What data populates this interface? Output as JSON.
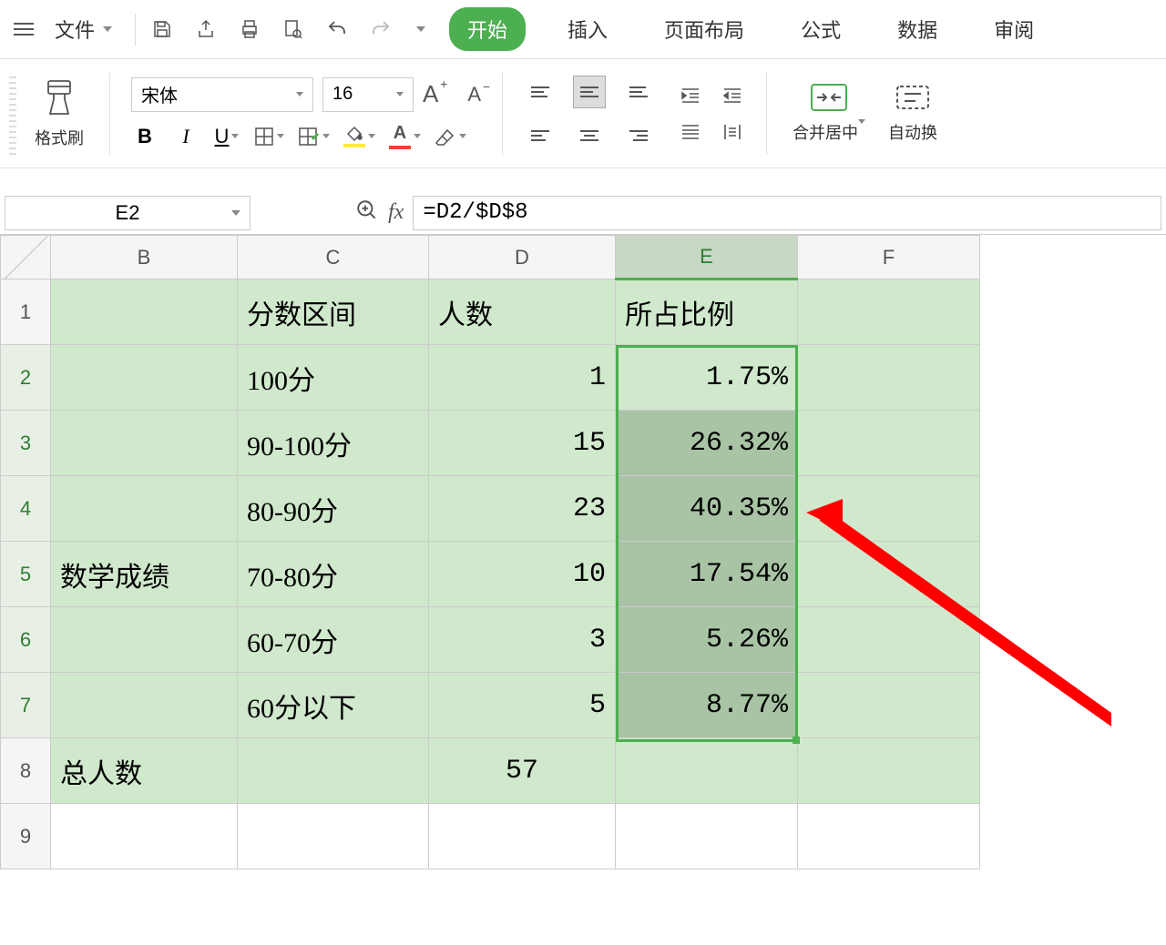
{
  "menu": {
    "file": "文件",
    "tabs": [
      "开始",
      "插入",
      "页面布局",
      "公式",
      "数据",
      "审阅"
    ],
    "active_tab_index": 0
  },
  "ribbon": {
    "format_painter": "格式刷",
    "font_name": "宋体",
    "font_size": "16",
    "a_plus": "A",
    "a_minus": "A",
    "bold": "B",
    "italic": "I",
    "underline": "U",
    "merge_center": "合并居中",
    "auto_wrap": "自动换"
  },
  "formula_bar": {
    "cell_ref": "E2",
    "fx": "fx",
    "formula": "=D2/$D$8"
  },
  "grid": {
    "columns": [
      "B",
      "C",
      "D",
      "E",
      "F"
    ],
    "row_numbers": [
      "1",
      "2",
      "3",
      "4",
      "5",
      "6",
      "7",
      "8",
      "9"
    ],
    "headers": {
      "C": "分数区间",
      "D": "人数",
      "E": "所占比例"
    },
    "side_label": "数学成绩",
    "total_label": "总人数",
    "rows": [
      {
        "range": "100分",
        "count": "1",
        "pct": "1.75%"
      },
      {
        "range": "90-100分",
        "count": "15",
        "pct": "26.32%"
      },
      {
        "range": "80-90分",
        "count": "23",
        "pct": "40.35%"
      },
      {
        "range": "70-80分",
        "count": "10",
        "pct": "17.54%"
      },
      {
        "range": "60-70分",
        "count": "3",
        "pct": "5.26%"
      },
      {
        "range": "60分以下",
        "count": "5",
        "pct": "8.77%"
      }
    ],
    "total_count": "57"
  }
}
